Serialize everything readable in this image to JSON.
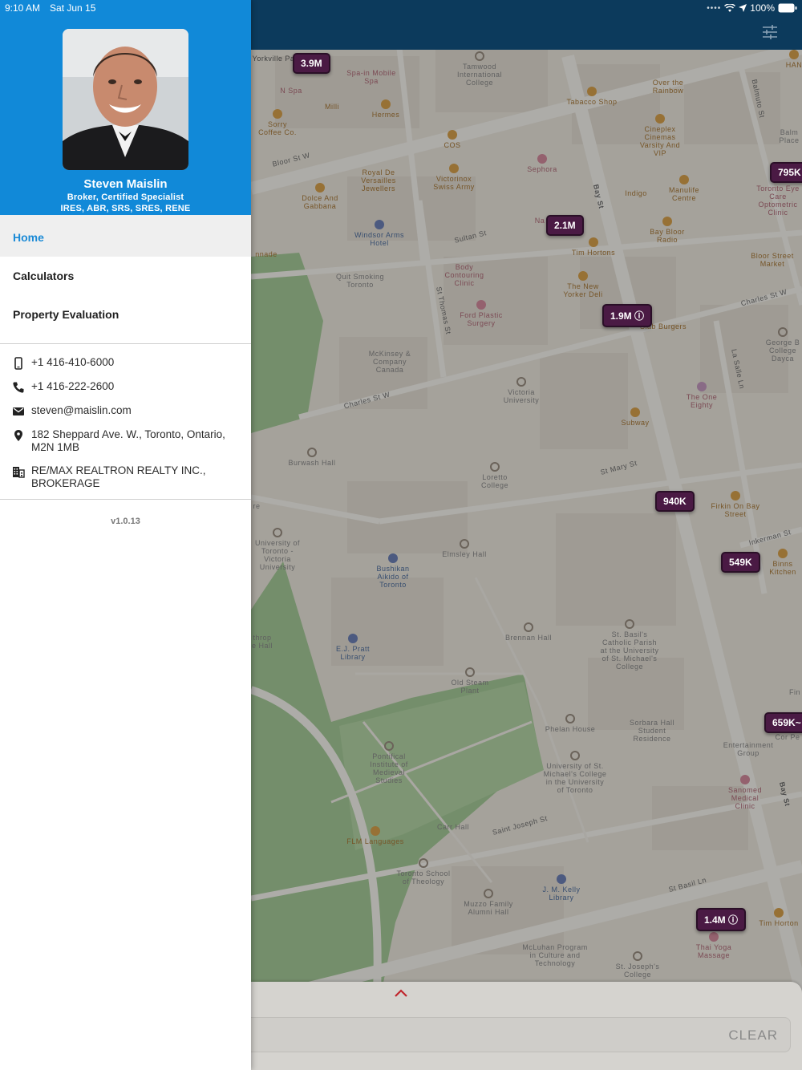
{
  "status_bar": {
    "time": "9:10 AM",
    "date": "Sat Jun 15",
    "battery": "100%"
  },
  "agent": {
    "name": "Steven Maislin",
    "title_line1": "Broker, Certified Specialist",
    "title_line2": "IRES, ABR, SRS, SRES, RENE"
  },
  "nav": {
    "items": [
      {
        "label": "Home"
      },
      {
        "label": "Calculators"
      },
      {
        "label": "Property Evaluation"
      }
    ]
  },
  "contact": {
    "mobile": "+1 416-410-6000",
    "phone": "+1 416-222-2600",
    "email": "steven@maislin.com",
    "address": "182 Sheppard Ave. W., Toronto, Ontario, M2N 1MB",
    "brokerage": "RE/MAX REALTRON REALTY INC., BROKERAGE"
  },
  "version": "v1.0.13",
  "map": {
    "listings": [
      {
        "label": "3.9M"
      },
      {
        "label": "795K"
      },
      {
        "label": "2.1M"
      },
      {
        "label": "1.9M"
      },
      {
        "label": "940K"
      },
      {
        "label": "549K"
      },
      {
        "label": "659K"
      },
      {
        "label": "1.4M"
      }
    ],
    "streets": [
      "Bloor St W",
      "Bay St",
      "Sultan St",
      "St Thomas St",
      "Charles St W",
      "St Mary St",
      "Charles St W",
      "Saint Joseph St",
      "St Basil Ln",
      "Bay St",
      "Inkerman St",
      "Balmuto St",
      "La Salle Ln"
    ],
    "pois": [
      "Tamwood International College",
      "Spa-in Mobile Spa",
      "N Spa",
      "Milli",
      "Hermes",
      "Sorry Coffee Co.",
      "Tabacco Shop",
      "Over the Rainbow",
      "Cineplex Cinemas Varsity And VIP",
      "COS",
      "Sephora",
      "Royal De Versailles Jewellers",
      "Victorinox Swiss Army",
      "Dolce And Gabbana",
      "Indigo",
      "Manulife Centre",
      "Toronto Eye Care Optometric Clinic",
      "Windsor Arms Hotel",
      "Bay Bloor Radio",
      "Body Contouring Clinic",
      "Tim Hortons",
      "Quit Smoking Toronto",
      "The New Yorker Deli",
      "Bloor Street Market",
      "Ford Plastic Surgery",
      "Slab Burgers",
      "McKinsey & Company Canada",
      "Victoria University",
      "The One Eighty",
      "Subway",
      "Burwash Hall",
      "Loretto College",
      "Firkin On Bay Street",
      "University of Toronto - Victoria University",
      "Elmsley Hall",
      "Bushikan Aikido of Toronto",
      "Binns Kitchen",
      "E.J. Pratt Library",
      "Brennan Hall",
      "St. Basil's Catholic Parish at the University of St. Michael's College",
      "Old Steam Plant",
      "Phelan House",
      "Sorbara Hall Student Residence",
      "Pontifical Institute of Medieval Studies",
      "University of St. Michael's College in the University of Toronto",
      "Entertainment Group",
      "Sanomed Medical Clinic",
      "Carr Hall",
      "FLM Languages",
      "Toronto School of Theology",
      "Muzzo Family Alumni Hall",
      "J. M. Kelly Library",
      "McLuhan Program in Culture and Technology",
      "St. Joseph's College",
      "Thai Yoga Massage",
      "Tim Horton",
      "Yorkville Pa",
      "George B College Dayca",
      "Balm Place",
      "HAN",
      "Na",
      "nnade",
      "re",
      "throp e Hall",
      "Fin",
      "Cor Pe"
    ]
  },
  "bottom_sheet": {
    "clear_label": "CLEAR"
  }
}
